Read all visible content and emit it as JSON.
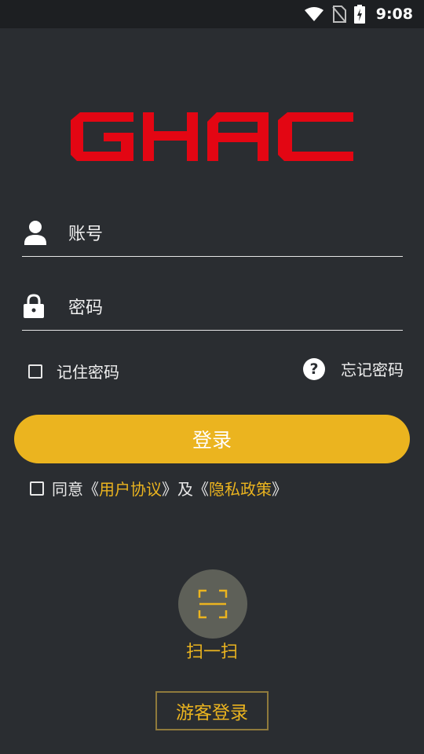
{
  "status_bar": {
    "time": "9:08"
  },
  "brand": {
    "logo_text": "GHAC",
    "logo_color": "#e30613"
  },
  "form": {
    "account_placeholder": "账号",
    "password_placeholder": "密码",
    "remember_label": "记住密码",
    "forgot_icon_text": "?",
    "forgot_label": "忘记密码",
    "login_label": "登录"
  },
  "agreement": {
    "prefix": "同意《",
    "user_agreement": "用户协议",
    "mid": "》及《",
    "privacy_policy": "隐私政策",
    "suffix": "》"
  },
  "scan": {
    "label": "扫一扫"
  },
  "guest": {
    "label": "游客登录"
  },
  "colors": {
    "accent": "#ebb41f",
    "background": "#2a2d31",
    "logo_red": "#e30613"
  },
  "icons": [
    "wifi-icon",
    "no-sim-icon",
    "battery-charging-icon",
    "user-icon",
    "lock-icon",
    "help-icon",
    "scan-icon"
  ]
}
